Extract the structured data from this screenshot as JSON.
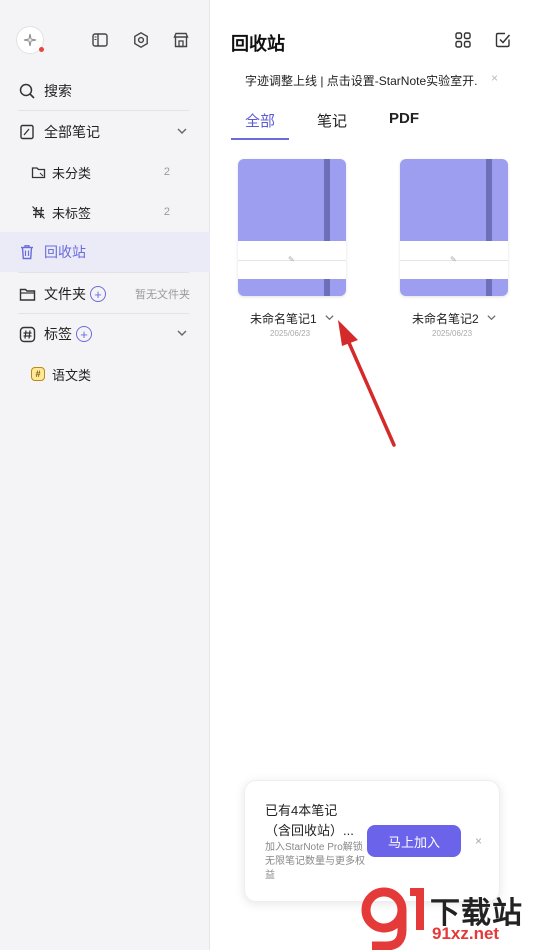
{
  "sidebar": {
    "search_label": "搜索",
    "all_notes_label": "全部笔记",
    "uncategorized_label": "未分类",
    "uncategorized_count": "2",
    "untagged_label": "未标签",
    "untagged_count": "2",
    "trash_label": "回收站",
    "folders_label": "文件夹",
    "folders_hint": "暂无文件夹",
    "tags_label": "标签",
    "tag_items": [
      {
        "badge": "#",
        "label": "语文类"
      }
    ]
  },
  "main": {
    "title": "回收站",
    "notice": "字迹调整上线 | 点击设置-StarNote实验室开...",
    "notice_close": "×",
    "tabs": [
      "全部",
      "笔记",
      "PDF"
    ],
    "notes": [
      {
        "name": "未命名笔记1",
        "date": "2025/06/23"
      },
      {
        "name": "未命名笔记2",
        "date": "2025/06/23"
      }
    ]
  },
  "promo": {
    "title": "已有4本笔记（含回收站）...",
    "desc": "加入StarNote Pro解锁无限笔记数量与更多权益",
    "button": "马上加入",
    "close": "×"
  },
  "watermark": {
    "text": "下载站",
    "url": "91xz.net"
  },
  "colors": {
    "accent": "#6b6bdc",
    "cover": "#9d9ef0",
    "arrow": "#d42a2a"
  }
}
